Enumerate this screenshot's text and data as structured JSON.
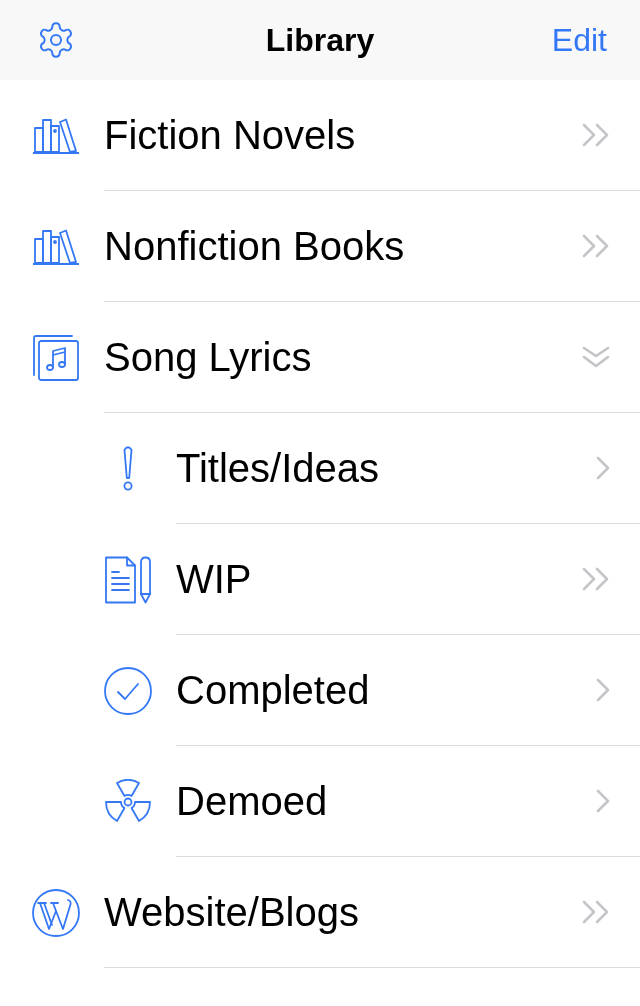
{
  "nav_bar": {
    "title": "Library",
    "edit": "Edit"
  },
  "library": [
    {
      "label": "Fiction Novels",
      "kind": "group",
      "expanded": false
    },
    {
      "label": "Nonfiction Books",
      "kind": "group",
      "expanded": false
    },
    {
      "label": "Song Lyrics",
      "kind": "group",
      "expanded": true,
      "children": [
        {
          "label": "Titles/Ideas",
          "kind": "item"
        },
        {
          "label": "WIP",
          "kind": "group",
          "expanded": false
        },
        {
          "label": "Completed",
          "kind": "item"
        },
        {
          "label": "Demoed",
          "kind": "item"
        }
      ]
    },
    {
      "label": "Website/Blogs",
      "kind": "group",
      "expanded": false
    }
  ]
}
